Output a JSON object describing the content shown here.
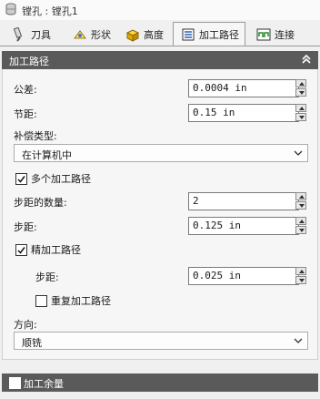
{
  "window": {
    "title": "镗孔 : 镗孔1",
    "icon": "hole-icon"
  },
  "tabs": [
    {
      "label": "刀具",
      "icon": "tool-icon",
      "active": false
    },
    {
      "label": "形状",
      "icon": "shape-icon",
      "active": false
    },
    {
      "label": "高度",
      "icon": "height-icon",
      "active": false
    },
    {
      "label": "加工路径",
      "icon": "passes-icon",
      "active": true
    },
    {
      "label": "连接",
      "icon": "linking-icon",
      "active": false
    }
  ],
  "section": {
    "title": "加工路径",
    "collapse_icon": "double-chevron-up-icon"
  },
  "fields": {
    "tolerance": {
      "label": "公差:",
      "value": "0.0004 in"
    },
    "stepover": {
      "label": "节距:",
      "value": "0.15 in"
    },
    "compensation": {
      "label": "补偿类型:",
      "selected": "在计算机中"
    },
    "multiple_passes": {
      "label": "多个加工路径",
      "checked": true
    },
    "num_steps": {
      "label": "步距的数量:",
      "value": "2"
    },
    "step": {
      "label": "步距:",
      "value": "0.125 in"
    },
    "finish_pass": {
      "label": "精加工路径",
      "checked": true
    },
    "finish_step": {
      "label": "步距:",
      "value": "0.025 in"
    },
    "repeat_finish": {
      "label": "重复加工路径",
      "checked": false
    },
    "direction": {
      "label": "方向:",
      "selected": "顺铣"
    }
  },
  "footer": {
    "label": "加工余量",
    "checked": false
  },
  "colors": {
    "header_bg": "#5a5a5a",
    "panel_bg": "#f6f6f6"
  }
}
